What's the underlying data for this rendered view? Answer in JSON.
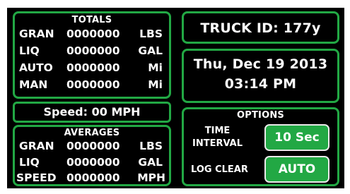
{
  "totals": {
    "title": "TOTALS",
    "rows": [
      {
        "label": "GRAN",
        "value": "0000000",
        "unit": "LBS"
      },
      {
        "label": "LIQ",
        "value": "0000000",
        "unit": "GAL"
      },
      {
        "label": "AUTO",
        "value": "0000000",
        "unit": "Mi"
      },
      {
        "label": "MAN",
        "value": "0000000",
        "unit": "Mi"
      }
    ]
  },
  "speed": {
    "text": "Speed: 00 MPH"
  },
  "averages": {
    "title": "AVERAGES",
    "rows": [
      {
        "label": "GRAN",
        "value": "0000000",
        "unit": "LBS"
      },
      {
        "label": "LIQ",
        "value": "0000000",
        "unit": "GAL"
      },
      {
        "label": "SPEED",
        "value": "0000000",
        "unit": "MPH"
      }
    ]
  },
  "truck": {
    "id_text": "TRUCK ID: 177y"
  },
  "datetime": {
    "date": "Thu, Dec 19 2013",
    "time": "03:14 PM"
  },
  "options": {
    "title": "OPTIONS",
    "time_interval_label_line1": "TIME",
    "time_interval_label_line2": "INTERVAL",
    "time_interval_value": "10 Sec",
    "log_clear_label": "LOG CLEAR",
    "log_clear_value": "AUTO"
  },
  "colors": {
    "accent_green": "#22a844",
    "background": "#000000",
    "text": "#ffffff"
  }
}
